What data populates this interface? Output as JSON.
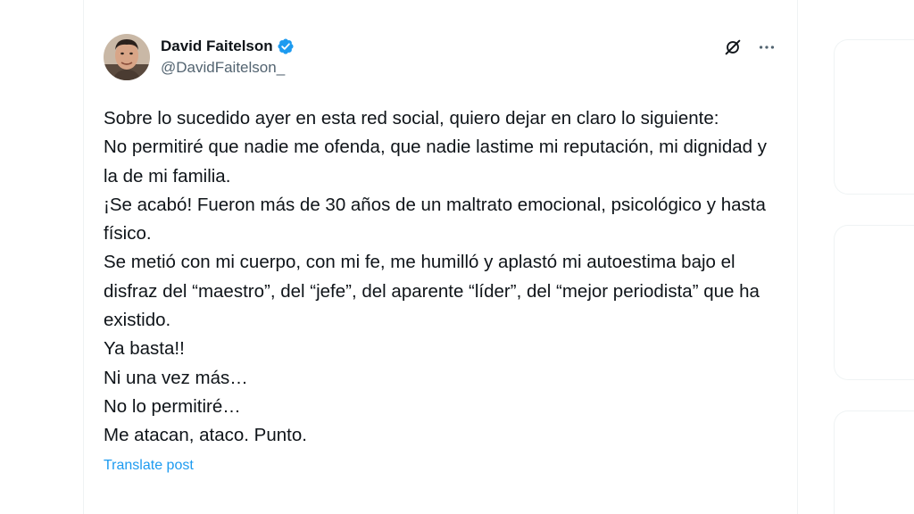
{
  "author": {
    "name": "David Faitelson",
    "handle": "@DavidFaitelson_",
    "verified": true,
    "verified_color": "#1d9bf0"
  },
  "icons": {
    "avatar": "avatar-photo",
    "verified": "verified-badge-icon",
    "grok": "grok-icon",
    "more": "more-options-icon"
  },
  "tweet": {
    "lines": [
      "Sobre lo sucedido ayer en esta red social, quiero dejar en claro lo siguiente:",
      "No permitiré que nadie me ofenda, que nadie lastime mi reputación, mi dignidad y la de mi familia.",
      "¡Se acabó! Fueron más de 30 años de un maltrato emocional, psicológico y hasta físico.",
      "Se metió con mi cuerpo, con mi fe, me humilló y aplastó mi autoestima bajo el disfraz del “maestro”, del “jefe”, del aparente “líder”, del “mejor periodista” que ha existido.",
      "Ya basta!!",
      "Ni una vez más…",
      "No lo permitiré…",
      "Me atacan, ataco. Punto."
    ],
    "translate_label": "Translate post"
  },
  "colors": {
    "text": "#0f1419",
    "secondary": "#536471",
    "link": "#1d9bf0",
    "border": "#eff3f4"
  }
}
